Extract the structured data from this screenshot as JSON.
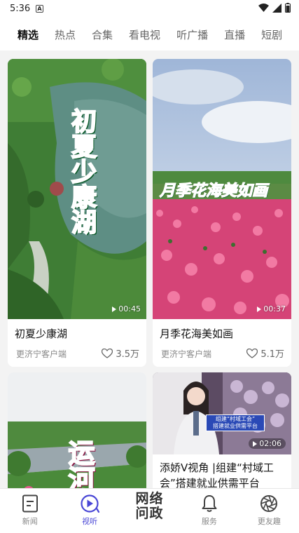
{
  "status_bar": {
    "time": "5:36",
    "badge": "A"
  },
  "tabs": [
    "精选",
    "热点",
    "合集",
    "看电视",
    "听广播",
    "直播",
    "短剧"
  ],
  "active_tab": "精选",
  "cards": [
    {
      "overlay_text": "初夏少康湖",
      "duration": "00:45",
      "title": "初夏少康湖",
      "source": "更济宁客户端",
      "likes": "3.5万"
    },
    {
      "overlay_text": "月季花海美如画",
      "duration": "00:37",
      "title": "月季花海美如画",
      "source": "更济宁客户端",
      "likes": "5.1万"
    },
    {
      "overlay_text": "运河"
    },
    {
      "duration": "02:06",
      "title_line1": "添娇V视角 |组建“村域工",
      "title_line2": "会”搭建就业供需平台",
      "banner_line1": "组建“村域工会”",
      "banner_line2": "搭建就业供需平台"
    }
  ],
  "bottom_nav": [
    {
      "label": "新闻",
      "icon": "news-icon"
    },
    {
      "label": "视听",
      "icon": "play-circle-icon",
      "active": true
    },
    {
      "logo_line1": "网络",
      "logo_line2": "问政"
    },
    {
      "label": "服务",
      "icon": "bell-icon"
    },
    {
      "label": "更友趣",
      "icon": "aperture-icon"
    }
  ],
  "colors": {
    "accent": "#4a47d6",
    "background": "#f3f3f3"
  }
}
